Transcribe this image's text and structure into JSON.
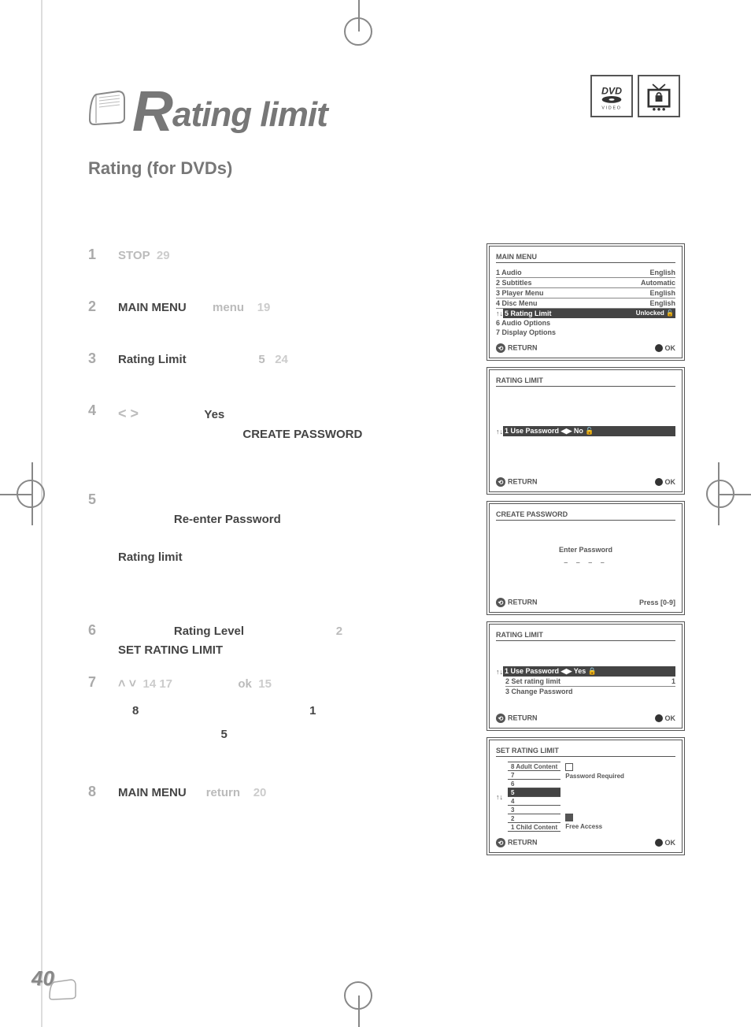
{
  "title": {
    "cap": "R",
    "rest": "ating limit"
  },
  "logos": {
    "dvd_top": "DVD",
    "dvd_bottom": "VIDEO"
  },
  "subtitle": "Rating (for DVDs)",
  "page_number": "40",
  "steps": {
    "s1": {
      "num": "1",
      "kw": "STOP",
      "pg": "29"
    },
    "s2": {
      "num": "2",
      "mm": "MAIN MENU",
      "menu": "menu",
      "pg": "19"
    },
    "s3": {
      "num": "3",
      "rl": "Rating Limit",
      "five": "5",
      "pg": "24"
    },
    "s4": {
      "num": "4",
      "arrows": "< >",
      "yes": "Yes",
      "cp": "CREATE PASSWORD"
    },
    "s5": {
      "num": "5",
      "re": "Re-enter Password",
      "rl": "Rating limit"
    },
    "s6": {
      "num": "6",
      "rlevel": "Rating Level",
      "two": "2",
      "srl": "SET RATING LIMIT"
    },
    "s7": {
      "num": "7",
      "ud": "14  17",
      "ok": "ok",
      "okpg": "15",
      "eight": "8",
      "one": "1",
      "five": "5"
    },
    "s8": {
      "num": "8",
      "mm": "MAIN MENU",
      "ret": "return",
      "pg": "20"
    }
  },
  "screen1": {
    "title": "MAIN MENU",
    "r1l": "1  Audio",
    "r1r": "English",
    "r2l": "2  Subtitles",
    "r2r": "Automatic",
    "r3l": "3  Player Menu",
    "r3r": "English",
    "r4l": "4  Disc Menu",
    "r4r": "English",
    "r5pre": "↑↓",
    "r5l": "5  Rating Limit",
    "r5r": "Unlocked 🔓",
    "r6l": "6  Audio Options",
    "r7l": "7  Display Options",
    "ret": "RETURN",
    "ok": "OK",
    "retsym": "⟲"
  },
  "screen2": {
    "title": "RATING LIMIT",
    "pre": "↑↓",
    "row": "1 Use Password  ◀▶   No   🔓",
    "ret": "RETURN",
    "ok": "OK",
    "retsym": "⟲"
  },
  "screen3": {
    "title": "CREATE PASSWORD",
    "enter": "Enter Password",
    "dashes": "– – – –",
    "ret": "RETURN",
    "press": "Press [0-9]",
    "retsym": "⟲"
  },
  "screen4": {
    "title": "RATING LIMIT",
    "pre": "↑↓",
    "r1": "1  Use Password   ◀▶   Yes   🔒",
    "r2l": "2  Set rating limit",
    "r2r": "1",
    "r3": "3  Change Password",
    "ret": "RETURN",
    "ok": "OK",
    "retsym": "⟲"
  },
  "screen5": {
    "title": "SET RATING LIMIT",
    "levels": [
      "8 Adult Content",
      "7",
      "6",
      "5",
      "4",
      "3",
      "2",
      "1 Child Content"
    ],
    "pre": "↑↓",
    "pwreq": "Password Required",
    "free": "Free Access",
    "ret": "RETURN",
    "ok": "OK",
    "retsym": "⟲"
  }
}
